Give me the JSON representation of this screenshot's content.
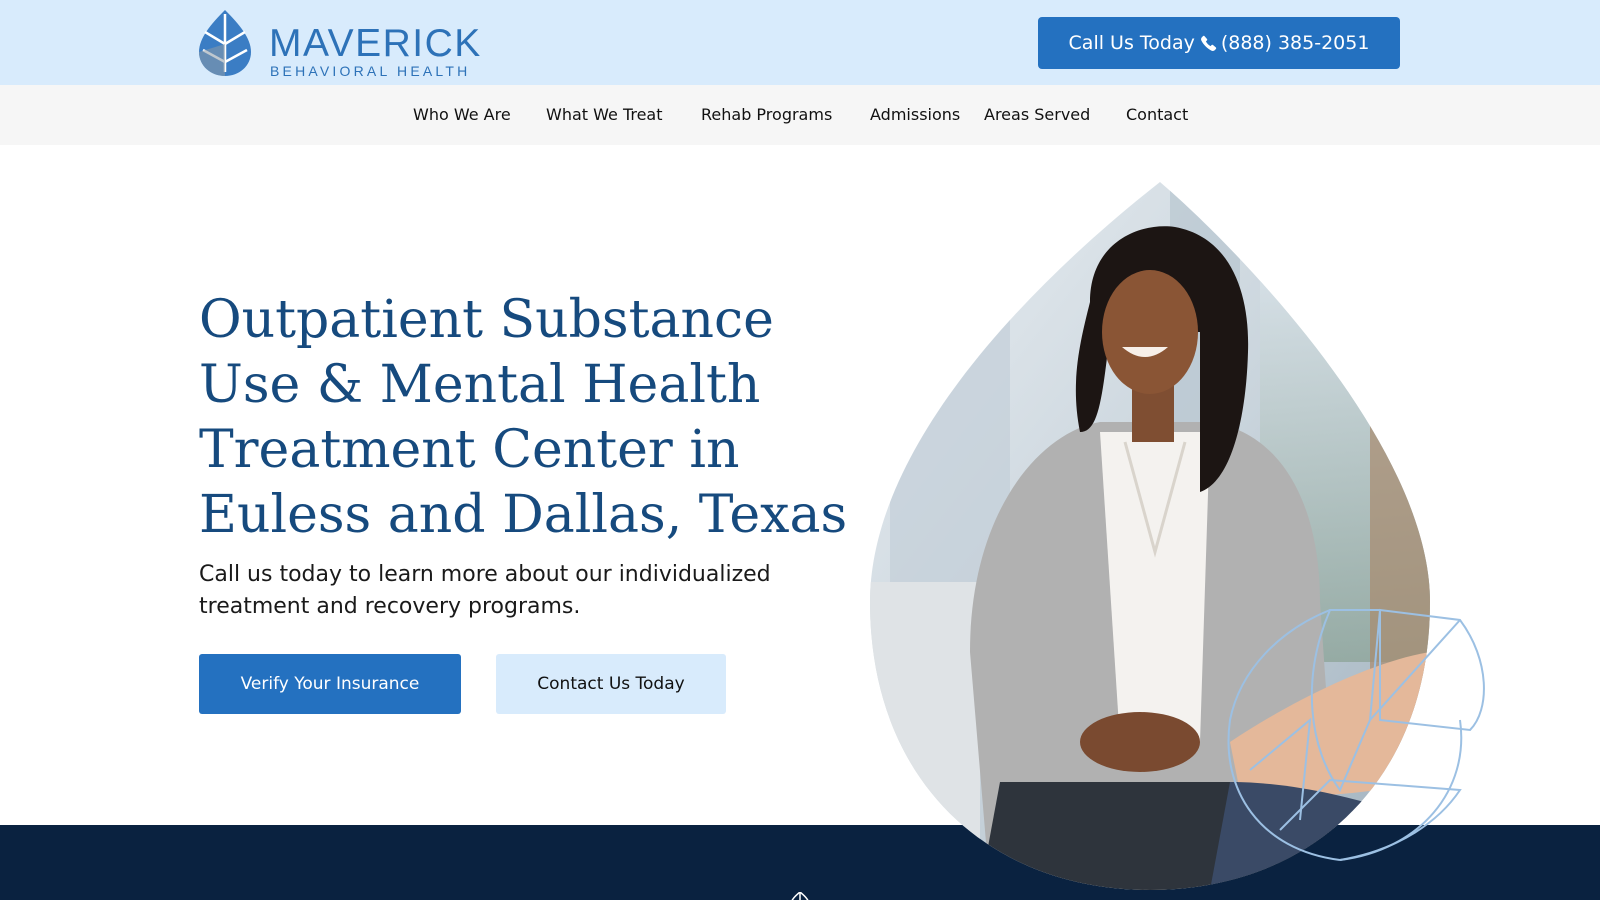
{
  "brand": {
    "name": "MAVERICK",
    "tagline": "BEHAVIORAL HEALTH",
    "logo_icon": "leaf-logo-icon",
    "primary_color": "#2471c0",
    "dark_color": "#0a2240",
    "light_color": "#d8ebfc",
    "heading_color": "#164a7e"
  },
  "header": {
    "call_label": "Call Us Today",
    "phone_icon": "phone-icon",
    "phone_number": "(888) 385-2051"
  },
  "nav": {
    "items": [
      {
        "label": "Who We Are"
      },
      {
        "label": "What We Treat"
      },
      {
        "label": "Rehab Programs"
      },
      {
        "label": "Admissions"
      },
      {
        "label": "Areas Served"
      },
      {
        "label": "Contact"
      }
    ]
  },
  "hero": {
    "title": "Outpatient Substance Use & Mental Health Treatment Center in Euless and Dallas, Texas",
    "subtitle": "Call us today to learn more about our individualized treatment and recovery programs.",
    "primary_button": "Verify Your Insurance",
    "secondary_button": "Contact Us Today",
    "image": "woman-in-group-therapy-photo"
  }
}
